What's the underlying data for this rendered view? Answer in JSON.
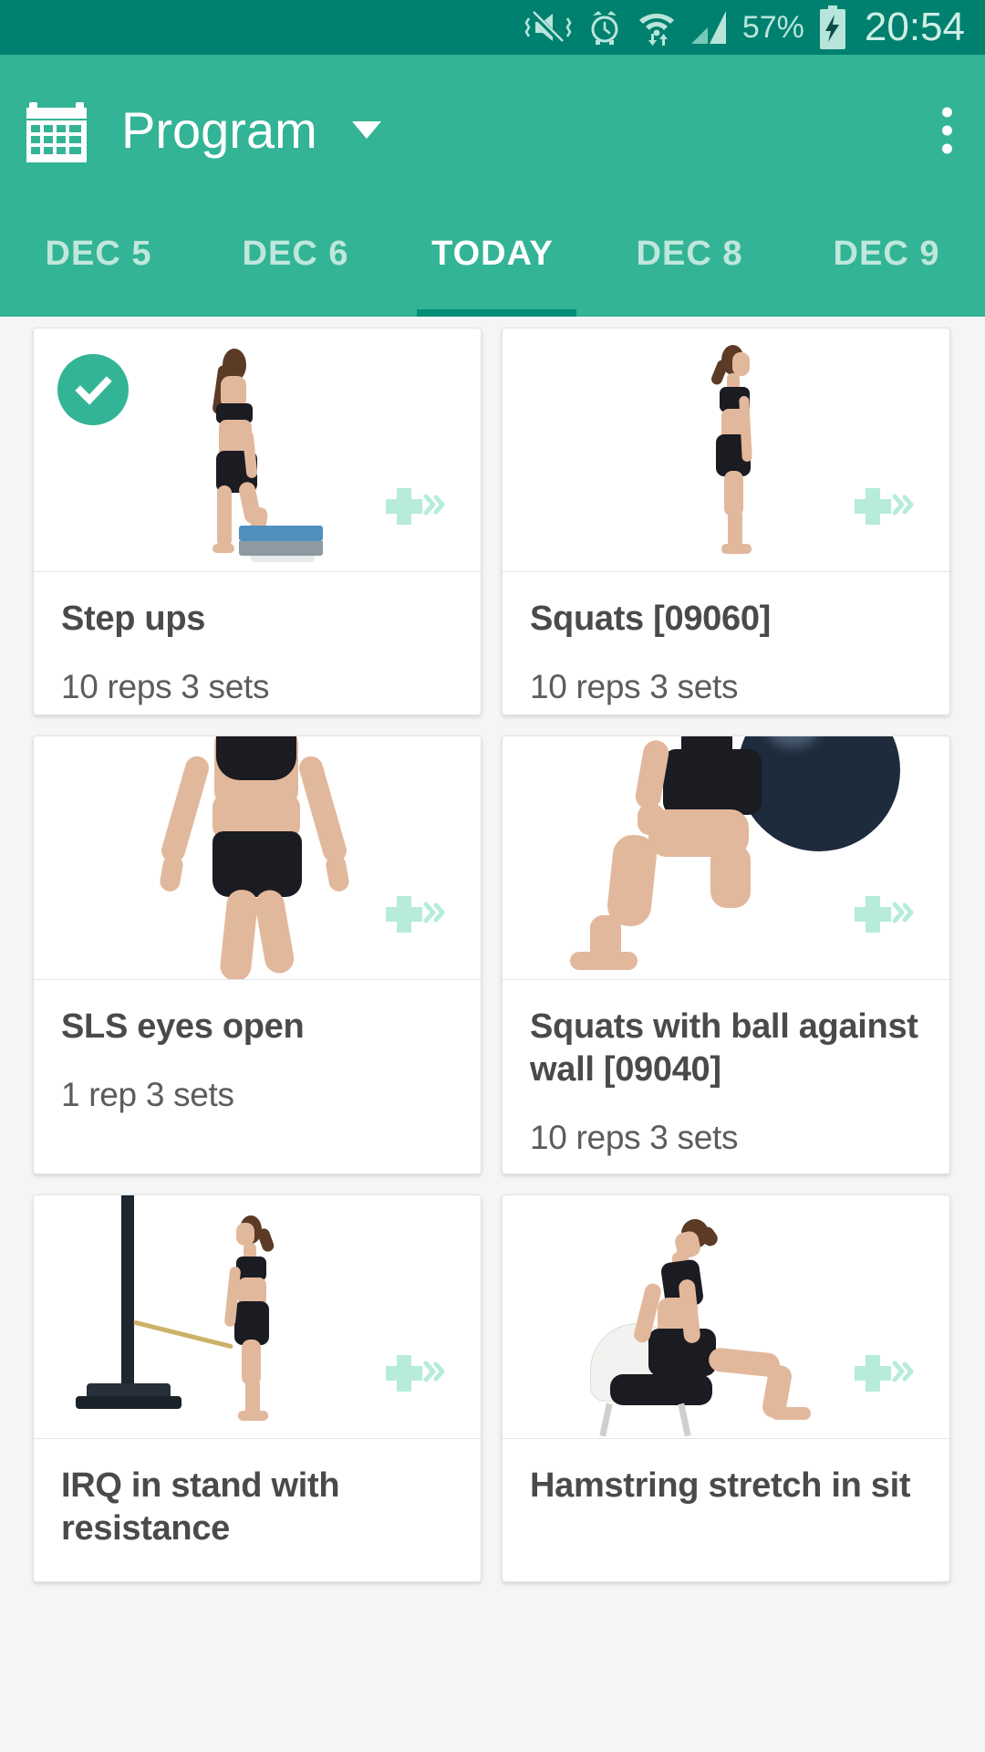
{
  "statusbar": {
    "icons": [
      "vibrate-mute-icon",
      "alarm-clock-icon",
      "wifi-icon",
      "signal-icon"
    ],
    "battery_percent": "57%",
    "battery_icon": "battery-charging-icon",
    "clock": "20:54"
  },
  "appbar": {
    "leading_icon": "calendar-icon",
    "title": "Program",
    "dropdown_icon": "chevron-down-icon",
    "overflow_icon": "overflow-menu-icon"
  },
  "tabs": {
    "items": [
      {
        "label": "DEC 5",
        "active": false
      },
      {
        "label": "DEC 6",
        "active": false
      },
      {
        "label": "TODAY",
        "active": true
      },
      {
        "label": "DEC 8",
        "active": false
      },
      {
        "label": "DEC 9",
        "active": false
      }
    ],
    "active_index": 2
  },
  "colors": {
    "status_bar": "#00806e",
    "app_bar": "#33b496",
    "tab_indicator": "#008f78",
    "accent": "#33b496",
    "plus_icon": "#b6ecd9",
    "page_background": "#f4f5f6",
    "card_background": "#ffffff",
    "title_text": "#4a4a4a",
    "sub_text": "#5c5c5c",
    "tab_inactive_text": "#bfe7dc",
    "tab_active_text": "#ffffff"
  },
  "exercises": [
    {
      "title": "Step ups",
      "subtitle": "10 reps 3 sets",
      "completed": true,
      "badge_icon": "check-circle-icon",
      "action_icon": "plus-motion-icon",
      "image": "woman-step-up-on-blue-step"
    },
    {
      "title": "Squats [09060]",
      "subtitle": "10 reps 3 sets",
      "completed": false,
      "action_icon": "plus-motion-icon",
      "image": "woman-standing-side-view"
    },
    {
      "title": "SLS eyes open",
      "subtitle": "1 rep 3 sets",
      "completed": false,
      "action_icon": "plus-motion-icon",
      "image": "woman-single-leg-stance-torso"
    },
    {
      "title": "Squats with ball against wall [09040]",
      "subtitle": "10 reps 3 sets",
      "completed": false,
      "action_icon": "plus-motion-icon",
      "image": "woman-squat-with-exercise-ball-against-wall"
    },
    {
      "title": "IRQ in stand with resistance",
      "subtitle": "",
      "completed": false,
      "action_icon": "plus-motion-icon",
      "image": "woman-standing-with-resistance-band-and-pole"
    },
    {
      "title": "Hamstring stretch in sit",
      "subtitle": "",
      "completed": false,
      "action_icon": "plus-motion-icon",
      "image": "woman-hamstring-stretch-seated-on-chair"
    }
  ]
}
